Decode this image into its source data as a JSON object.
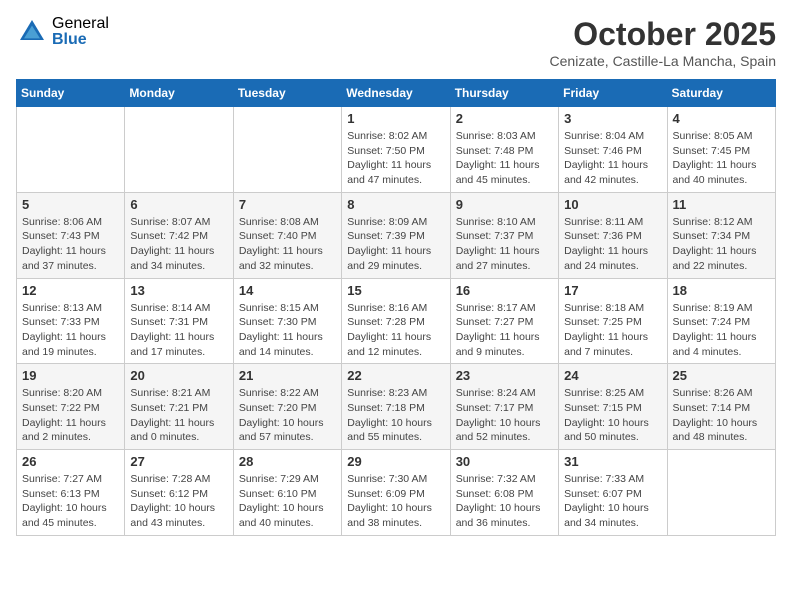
{
  "logo": {
    "general": "General",
    "blue": "Blue"
  },
  "title": "October 2025",
  "location": "Cenizate, Castille-La Mancha, Spain",
  "weekdays": [
    "Sunday",
    "Monday",
    "Tuesday",
    "Wednesday",
    "Thursday",
    "Friday",
    "Saturday"
  ],
  "weeks": [
    [
      {
        "day": "",
        "info": ""
      },
      {
        "day": "",
        "info": ""
      },
      {
        "day": "",
        "info": ""
      },
      {
        "day": "1",
        "info": "Sunrise: 8:02 AM\nSunset: 7:50 PM\nDaylight: 11 hours and 47 minutes."
      },
      {
        "day": "2",
        "info": "Sunrise: 8:03 AM\nSunset: 7:48 PM\nDaylight: 11 hours and 45 minutes."
      },
      {
        "day": "3",
        "info": "Sunrise: 8:04 AM\nSunset: 7:46 PM\nDaylight: 11 hours and 42 minutes."
      },
      {
        "day": "4",
        "info": "Sunrise: 8:05 AM\nSunset: 7:45 PM\nDaylight: 11 hours and 40 minutes."
      }
    ],
    [
      {
        "day": "5",
        "info": "Sunrise: 8:06 AM\nSunset: 7:43 PM\nDaylight: 11 hours and 37 minutes."
      },
      {
        "day": "6",
        "info": "Sunrise: 8:07 AM\nSunset: 7:42 PM\nDaylight: 11 hours and 34 minutes."
      },
      {
        "day": "7",
        "info": "Sunrise: 8:08 AM\nSunset: 7:40 PM\nDaylight: 11 hours and 32 minutes."
      },
      {
        "day": "8",
        "info": "Sunrise: 8:09 AM\nSunset: 7:39 PM\nDaylight: 11 hours and 29 minutes."
      },
      {
        "day": "9",
        "info": "Sunrise: 8:10 AM\nSunset: 7:37 PM\nDaylight: 11 hours and 27 minutes."
      },
      {
        "day": "10",
        "info": "Sunrise: 8:11 AM\nSunset: 7:36 PM\nDaylight: 11 hours and 24 minutes."
      },
      {
        "day": "11",
        "info": "Sunrise: 8:12 AM\nSunset: 7:34 PM\nDaylight: 11 hours and 22 minutes."
      }
    ],
    [
      {
        "day": "12",
        "info": "Sunrise: 8:13 AM\nSunset: 7:33 PM\nDaylight: 11 hours and 19 minutes."
      },
      {
        "day": "13",
        "info": "Sunrise: 8:14 AM\nSunset: 7:31 PM\nDaylight: 11 hours and 17 minutes."
      },
      {
        "day": "14",
        "info": "Sunrise: 8:15 AM\nSunset: 7:30 PM\nDaylight: 11 hours and 14 minutes."
      },
      {
        "day": "15",
        "info": "Sunrise: 8:16 AM\nSunset: 7:28 PM\nDaylight: 11 hours and 12 minutes."
      },
      {
        "day": "16",
        "info": "Sunrise: 8:17 AM\nSunset: 7:27 PM\nDaylight: 11 hours and 9 minutes."
      },
      {
        "day": "17",
        "info": "Sunrise: 8:18 AM\nSunset: 7:25 PM\nDaylight: 11 hours and 7 minutes."
      },
      {
        "day": "18",
        "info": "Sunrise: 8:19 AM\nSunset: 7:24 PM\nDaylight: 11 hours and 4 minutes."
      }
    ],
    [
      {
        "day": "19",
        "info": "Sunrise: 8:20 AM\nSunset: 7:22 PM\nDaylight: 11 hours and 2 minutes."
      },
      {
        "day": "20",
        "info": "Sunrise: 8:21 AM\nSunset: 7:21 PM\nDaylight: 11 hours and 0 minutes."
      },
      {
        "day": "21",
        "info": "Sunrise: 8:22 AM\nSunset: 7:20 PM\nDaylight: 10 hours and 57 minutes."
      },
      {
        "day": "22",
        "info": "Sunrise: 8:23 AM\nSunset: 7:18 PM\nDaylight: 10 hours and 55 minutes."
      },
      {
        "day": "23",
        "info": "Sunrise: 8:24 AM\nSunset: 7:17 PM\nDaylight: 10 hours and 52 minutes."
      },
      {
        "day": "24",
        "info": "Sunrise: 8:25 AM\nSunset: 7:15 PM\nDaylight: 10 hours and 50 minutes."
      },
      {
        "day": "25",
        "info": "Sunrise: 8:26 AM\nSunset: 7:14 PM\nDaylight: 10 hours and 48 minutes."
      }
    ],
    [
      {
        "day": "26",
        "info": "Sunrise: 7:27 AM\nSunset: 6:13 PM\nDaylight: 10 hours and 45 minutes."
      },
      {
        "day": "27",
        "info": "Sunrise: 7:28 AM\nSunset: 6:12 PM\nDaylight: 10 hours and 43 minutes."
      },
      {
        "day": "28",
        "info": "Sunrise: 7:29 AM\nSunset: 6:10 PM\nDaylight: 10 hours and 40 minutes."
      },
      {
        "day": "29",
        "info": "Sunrise: 7:30 AM\nSunset: 6:09 PM\nDaylight: 10 hours and 38 minutes."
      },
      {
        "day": "30",
        "info": "Sunrise: 7:32 AM\nSunset: 6:08 PM\nDaylight: 10 hours and 36 minutes."
      },
      {
        "day": "31",
        "info": "Sunrise: 7:33 AM\nSunset: 6:07 PM\nDaylight: 10 hours and 34 minutes."
      },
      {
        "day": "",
        "info": ""
      }
    ]
  ]
}
